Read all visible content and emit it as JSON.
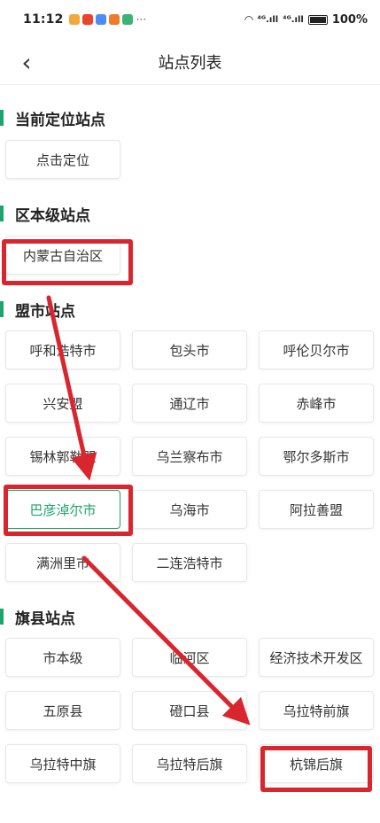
{
  "status_bar": {
    "time": "11:12",
    "dots": "···",
    "signal_1": "⁴ᴳ.ıll",
    "signal_2": "⁴ᴳ.ıll",
    "battery": "100%"
  },
  "nav": {
    "back_glyph": "‹",
    "title": "站点列表"
  },
  "sections": {
    "current": {
      "title": "当前定位站点",
      "items": [
        "点击定位"
      ]
    },
    "region": {
      "title": "区本级站点",
      "items": [
        "内蒙古自治区"
      ]
    },
    "league": {
      "title": "盟市站点",
      "items": [
        "呼和浩特市",
        "包头市",
        "呼伦贝尔市",
        "兴安盟",
        "通辽市",
        "赤峰市",
        "锡林郭勒盟",
        "乌兰察布市",
        "鄂尔多斯市",
        "巴彦淖尔市",
        "乌海市",
        "阿拉善盟",
        "满洲里市",
        "二连浩特市"
      ]
    },
    "county": {
      "title": "旗县站点",
      "items": [
        "市本级",
        "临河区",
        "经济技术开发区",
        "五原县",
        "磴口县",
        "乌拉特前旗",
        "乌拉特中旗",
        "乌拉特后旗",
        "杭锦后旗"
      ]
    }
  },
  "selected_league": "巴彦淖尔市",
  "colors": {
    "accent": "#1aa56a",
    "annotation_red": "#d9262e"
  }
}
